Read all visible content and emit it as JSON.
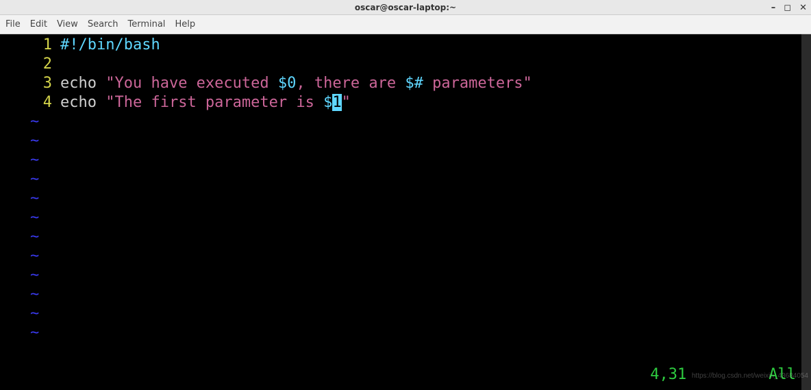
{
  "window": {
    "title": "oscar@oscar-laptop:~",
    "controls": {
      "min": "–",
      "max": "◻",
      "close": "✕"
    }
  },
  "menu": {
    "file": "File",
    "edit": "Edit",
    "view": "View",
    "search": "Search",
    "terminal": "Terminal",
    "help": "Help"
  },
  "code": {
    "ln1": {
      "num": "1",
      "shebang": "#!/bin/bash"
    },
    "ln2": {
      "num": "2"
    },
    "ln3": {
      "num": "3",
      "cmd": "echo ",
      "s1": "\"You have executed ",
      "v1": "$0",
      "s2": ", there are ",
      "v2": "$#",
      "s3": " parameters\""
    },
    "ln4": {
      "num": "4",
      "cmd": "echo ",
      "s1": "\"The first parameter is ",
      "v1": "$",
      "cursor": "1",
      "s2": "\""
    }
  },
  "tilde": "~",
  "status": {
    "pos": "4,31",
    "scroll": "All"
  },
  "watermark": "https://blog.csdn.net/weixin_43684054"
}
